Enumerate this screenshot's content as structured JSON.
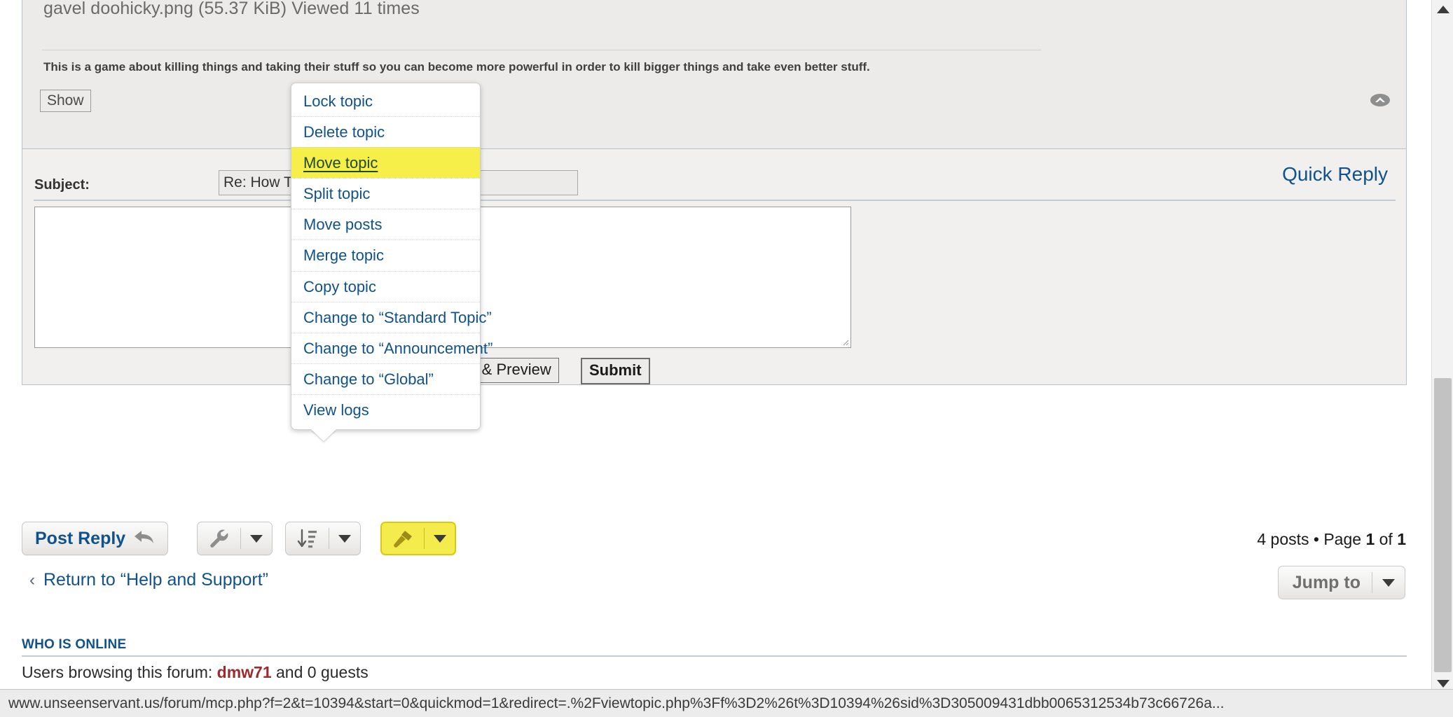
{
  "post": {
    "attachment_line": "gavel doohicky.png (55.37 KiB) Viewed 11 times",
    "body_text": "This is a game about killing things and taking their stuff so you can become more powerful in order to kill bigger things and take even better stuff.",
    "show_button": "Show",
    "collapse_icon": "chevron-up-circle-icon"
  },
  "quick_reply": {
    "title": "Quick Reply",
    "subject_label": "Subject:",
    "subject_value": "Re: How To",
    "message_value": "",
    "preview_button": "itor & Preview",
    "submit_button": "Submit"
  },
  "action_bar": {
    "post_reply_label": "Post Reply",
    "post_reply_icon": "reply-arrow-icon",
    "tools_icon": "wrench-icon",
    "tools_caret": "chevron-down-icon",
    "sort_icon": "sort-descending-icon",
    "sort_caret": "chevron-down-icon",
    "moderate_icon": "gavel-icon",
    "moderate_caret": "chevron-down-icon",
    "posts_text_prefix": "4 posts • Page ",
    "posts_page_current": "1",
    "posts_text_mid": " of ",
    "posts_page_total": "1"
  },
  "dropdown": {
    "items": [
      {
        "label": "Lock topic",
        "selected": false
      },
      {
        "label": "Delete topic",
        "selected": false
      },
      {
        "label": "Move topic",
        "selected": true
      },
      {
        "label": "Split topic",
        "selected": false
      },
      {
        "label": "Move posts",
        "selected": false
      },
      {
        "label": "Merge topic",
        "selected": false
      },
      {
        "label": "Copy topic",
        "selected": false
      },
      {
        "label": "Change to “Standard Topic”",
        "selected": false
      },
      {
        "label": "Change to “Announcement”",
        "selected": false
      },
      {
        "label": "Change to “Global”",
        "selected": false
      },
      {
        "label": "View logs",
        "selected": false
      }
    ]
  },
  "footer_nav": {
    "return_chevron": "chevron-left-icon",
    "return_label": "Return to “Help and Support”",
    "jump_label": "Jump to",
    "jump_caret": "chevron-down-icon"
  },
  "who_is_online": {
    "heading": "WHO IS ONLINE",
    "prefix": "Users browsing this forum: ",
    "user": "dmw71",
    "suffix": " and 0 guests"
  },
  "status_bar": {
    "url": "www.unseenservant.us/forum/mcp.php?f=2&t=10394&start=0&quickmod=1&redirect=.%2Fviewtopic.php%3Ff%3D2%26t%3D10394%26sid%3D305009431dbb0065312534b73c66726a..."
  },
  "scrollbar": {
    "up_arrow": "triangle-up-icon",
    "down_arrow": "triangle-down-icon"
  },
  "colors": {
    "link": "#105289",
    "highlight": "#f6ef4a",
    "moderate_button": "#f4ec4c",
    "user": "#9d2b2b",
    "panel": "#ecebe9"
  }
}
